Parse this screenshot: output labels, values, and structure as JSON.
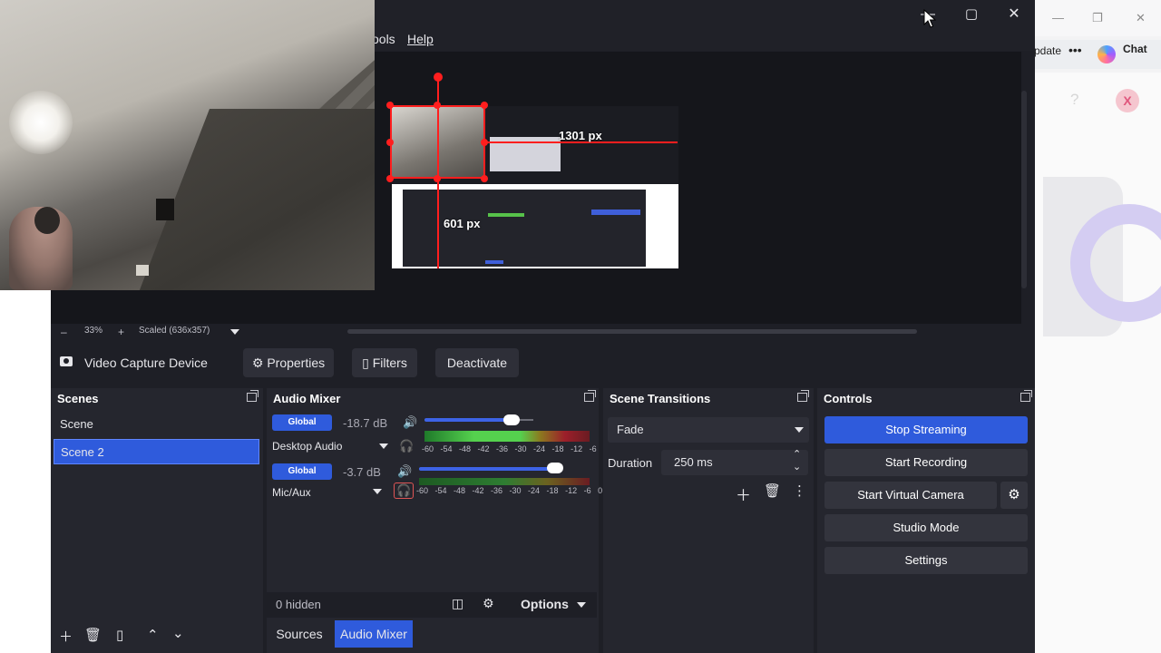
{
  "browser": {
    "update_label": "pdate",
    "more_label": "•••",
    "chat_label": "Chat",
    "window_controls": [
      "—",
      "❐",
      "✕"
    ],
    "help_icon": "?",
    "close_badge": "X"
  },
  "obs": {
    "window_controls": {
      "minimize": "—",
      "maximize": "▢",
      "close": "✕"
    },
    "menu": {
      "tools": "ools",
      "help": "Help"
    },
    "preview": {
      "width_label": "1301 px",
      "height_label": "601 px"
    },
    "zoom": {
      "minus": "–",
      "percent": "33%",
      "plus": "+",
      "scaled": "Scaled (636x357)"
    },
    "source_toolbar": {
      "source_name": "Video Capture Device",
      "properties": "Properties",
      "filters": "Filters",
      "deactivate": "Deactivate"
    },
    "scenes": {
      "title": "Scenes",
      "items": [
        "Scene",
        "Scene 2"
      ],
      "selected_index": 1
    },
    "audio_mixer": {
      "title": "Audio Mixer",
      "channels": [
        {
          "global": "Global",
          "db": "-18.7 dB",
          "name": "Desktop Audio",
          "volume": 0.8
        },
        {
          "global": "Global",
          "db": "-3.7 dB",
          "name": "Mic/Aux",
          "volume": 0.96
        }
      ],
      "scale": [
        "-60",
        "-54",
        "-48",
        "-42",
        "-36",
        "-30",
        "-24",
        "-18",
        "-12",
        "-6",
        "0"
      ],
      "hidden": "0 hidden",
      "options": "Options"
    },
    "dock_tabs": {
      "sources": "Sources",
      "mixer": "Audio Mixer"
    },
    "transitions": {
      "title": "Scene Transitions",
      "selected": "Fade",
      "duration_label": "Duration",
      "duration_value": "250 ms"
    },
    "controls": {
      "title": "Controls",
      "stop_streaming": "Stop Streaming",
      "start_recording": "Start Recording",
      "start_virtual_camera": "Start Virtual Camera",
      "studio_mode": "Studio Mode",
      "settings": "Settings"
    }
  },
  "colors": {
    "accent": "#2f5bdc",
    "panel": "#25262e",
    "window": "#1e1f26",
    "selection_red": "#ff1e1e"
  }
}
